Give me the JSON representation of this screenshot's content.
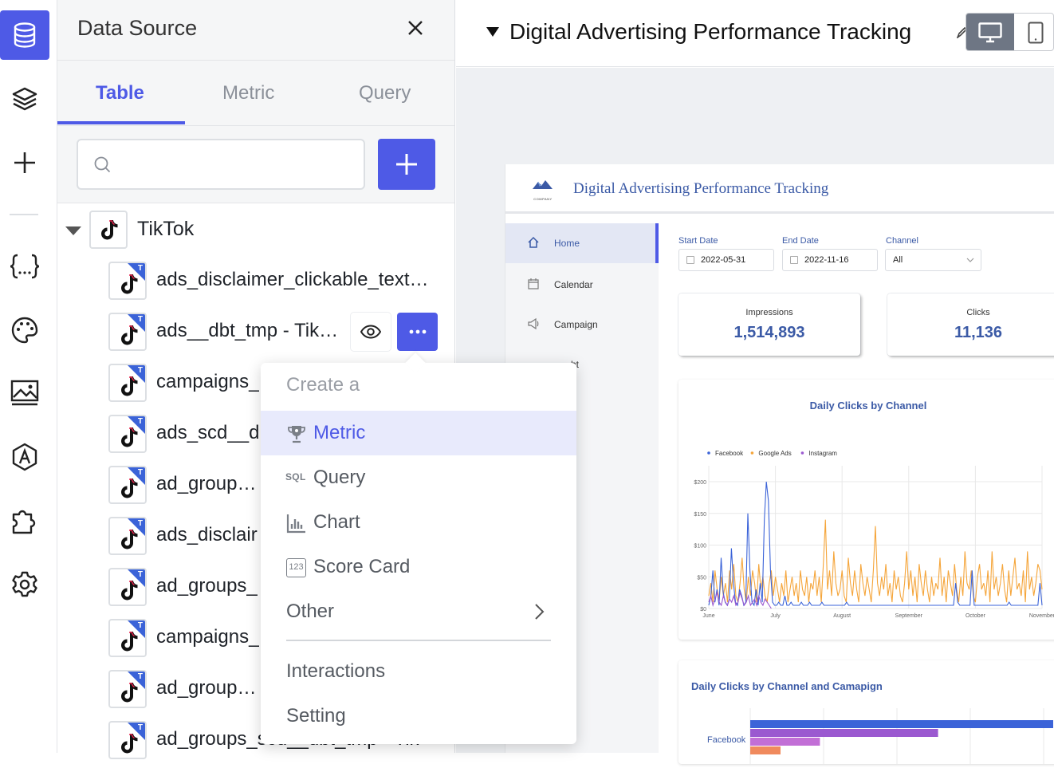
{
  "rail": {
    "items": [
      "data-source-icon",
      "layers-icon",
      "plus-icon",
      "variables-icon",
      "palette-icon",
      "image-icon",
      "theme-icon",
      "puzzle-icon",
      "gear-icon"
    ]
  },
  "panel": {
    "title": "Data Source",
    "tabs": [
      {
        "label": "Table",
        "active": true
      },
      {
        "label": "Metric",
        "active": false
      },
      {
        "label": "Query",
        "active": false
      }
    ],
    "search": {
      "placeholder": "",
      "value": ""
    },
    "tree": {
      "root": "TikTok",
      "tables": [
        "ads_disclaimer_clickable_text…",
        "ads__dbt_tmp - Tik…",
        "campaigns_",
        "ads_scd__d",
        "ad_groups_a",
        "ads_disclair",
        "ad_groups_",
        "campaigns_",
        "ad_groups_t",
        "ad_groups_scd__dbt_tmp - Tik"
      ]
    }
  },
  "menu": {
    "header": "Create a",
    "items": [
      {
        "label": "Metric",
        "icon": "trophy-icon",
        "selected": true
      },
      {
        "label": "Query",
        "icon": "sql-icon",
        "icon_text": "SQL",
        "selected": false
      },
      {
        "label": "Chart",
        "icon": "bar-chart-icon",
        "selected": false
      },
      {
        "label": "Score Card",
        "icon": "scorecard-icon",
        "icon_text": "123",
        "selected": false
      },
      {
        "label": "Other",
        "icon": "chevron-right-icon",
        "selected": false
      }
    ],
    "extra": [
      "Interactions",
      "Setting"
    ]
  },
  "canvas": {
    "title": "Digital Advertising Performance Tracking"
  },
  "dashboard": {
    "title": "Digital Advertising Performance Tracking",
    "logo_text": "COMPANY",
    "nav": [
      {
        "label": "Home",
        "active": true
      },
      {
        "label": "Calendar",
        "active": false
      },
      {
        "label": "Campaign",
        "active": false
      },
      {
        "label": "ht",
        "active": false
      }
    ],
    "filters": {
      "start_label": "Start Date",
      "start_value": "2022-05-31",
      "end_label": "End Date",
      "end_value": "2022-11-16",
      "channel_label": "Channel",
      "channel_value": "All"
    },
    "kpis": [
      {
        "label": "Impressions",
        "value": "1,514,893"
      },
      {
        "label": "Clicks",
        "value": "11,136"
      }
    ],
    "chart2_title": "Daily Clicks by Channel and Camapign",
    "chart2_label": "Facebook"
  },
  "chart_data": {
    "type": "line",
    "title": "Daily Clicks by Channel",
    "xlabel": "",
    "ylabel": "",
    "x_ticks": [
      "June",
      "July",
      "August",
      "September",
      "October",
      "November"
    ],
    "y_ticks": [
      "$0",
      "$50",
      "$100",
      "$150",
      "$200"
    ],
    "ylim": [
      0,
      200
    ],
    "legend_position": "top-left",
    "series": [
      {
        "name": "Facebook",
        "color": "#3b63d8",
        "values": [
          5,
          20,
          60,
          10,
          30,
          5,
          80,
          25,
          10,
          5,
          15,
          95,
          40,
          10,
          5,
          30,
          20,
          5,
          10,
          150,
          60,
          10,
          5,
          30,
          5,
          40,
          10,
          140,
          200,
          170,
          60,
          10,
          5,
          5,
          10,
          5,
          5,
          20,
          5,
          5,
          10,
          5,
          5,
          5,
          5,
          10,
          5,
          5,
          5,
          10,
          5,
          5,
          5,
          5,
          5,
          10,
          5,
          5,
          5,
          5,
          5,
          5,
          5,
          5,
          5,
          5,
          5,
          10,
          5,
          5,
          5,
          5,
          5,
          5,
          5,
          5,
          5,
          5,
          5,
          5,
          5,
          5,
          5,
          5,
          5,
          5,
          5,
          5,
          5,
          5,
          5,
          5,
          5,
          5,
          5,
          5,
          5,
          5,
          5,
          5,
          5,
          5,
          5,
          5,
          5,
          5,
          5,
          5,
          5,
          5,
          5,
          5,
          5,
          5,
          5,
          5,
          5,
          5,
          5,
          5,
          40,
          10,
          5,
          5,
          5,
          5,
          5,
          5,
          60,
          5,
          5,
          5,
          5,
          5,
          5,
          5,
          5,
          5,
          5,
          5,
          5,
          5,
          5,
          5,
          5,
          5,
          10,
          5,
          5,
          5,
          5,
          5,
          5,
          5,
          5,
          5,
          5,
          5,
          5,
          5,
          5,
          40,
          5
        ]
      },
      {
        "name": "Google Ads",
        "color": "#f5a53a",
        "values": [
          20,
          40,
          10,
          60,
          30,
          15,
          50,
          20,
          40,
          10,
          60,
          30,
          70,
          20,
          10,
          40,
          80,
          30,
          10,
          50,
          20,
          60,
          40,
          10,
          70,
          30,
          50,
          20,
          10,
          40,
          60,
          20,
          50,
          30,
          10,
          40,
          20,
          60,
          10,
          30,
          50,
          20,
          40,
          10,
          60,
          30,
          20,
          50,
          10,
          40,
          30,
          60,
          20,
          50,
          10,
          70,
          140,
          30,
          60,
          20,
          90,
          40,
          20,
          30,
          60,
          20,
          10,
          80,
          40,
          20,
          60,
          30,
          10,
          70,
          40,
          20,
          50,
          30,
          10,
          60,
          130,
          40,
          20,
          50,
          30,
          70,
          20,
          40,
          10,
          60,
          30,
          50,
          20,
          10,
          40,
          90,
          30,
          60,
          20,
          50,
          10,
          70,
          40,
          20,
          60,
          30,
          10,
          50,
          20,
          40,
          30,
          80,
          20,
          50,
          10,
          60,
          40,
          20,
          70,
          30,
          10,
          50,
          20,
          90,
          40,
          30,
          60,
          20,
          10,
          50,
          70,
          30,
          40,
          20,
          60,
          10,
          90,
          30,
          50,
          20,
          40,
          70,
          30,
          10,
          60,
          20,
          50,
          80,
          30,
          40,
          20,
          60,
          10,
          90,
          30,
          50,
          20,
          40,
          70,
          60,
          30
        ]
      },
      {
        "name": "Instagram",
        "color": "#9b59d0",
        "values": [
          10,
          20,
          5,
          15,
          25,
          10,
          5,
          20,
          10,
          5,
          15,
          10,
          20,
          5,
          10,
          25,
          15,
          5,
          10,
          20,
          5,
          10,
          15,
          5,
          20,
          10,
          5,
          15,
          10,
          5,
          0,
          0,
          0,
          0,
          0,
          0,
          0,
          0,
          0,
          0,
          0,
          0,
          0,
          0,
          0,
          0,
          0,
          0,
          0,
          0,
          0,
          0,
          0,
          0,
          0,
          0,
          0,
          0,
          0,
          0,
          0,
          0,
          0,
          0,
          0,
          0,
          0,
          0,
          0,
          0,
          0,
          0,
          0,
          0,
          0,
          0,
          0,
          0,
          0,
          0,
          0,
          0,
          0,
          0,
          0,
          0,
          0,
          0,
          0,
          0,
          0,
          0,
          0,
          0,
          0,
          0,
          0,
          0,
          0,
          0,
          0,
          0,
          0,
          0,
          0,
          0,
          0,
          0,
          0,
          0,
          0,
          0,
          0,
          0,
          0,
          0,
          0,
          0,
          0,
          0,
          0,
          0,
          0,
          0,
          0,
          0,
          0,
          0,
          0,
          0,
          0,
          0,
          0,
          0,
          0,
          0,
          0,
          0,
          0,
          0,
          0,
          0,
          0,
          0,
          0,
          0,
          0,
          0,
          0,
          0,
          0,
          0,
          0,
          0,
          0,
          0,
          0,
          0,
          0,
          0,
          0
        ]
      }
    ]
  },
  "chart2_data": {
    "type": "bar",
    "title": "Daily Clicks by Channel and Camapign",
    "categories": [
      "Facebook"
    ],
    "series_colors": [
      "#3b63d8",
      "#9b59d0",
      "#c26fd6",
      "#f08a5d"
    ],
    "values": [
      1.0,
      0.62,
      0.23,
      0.1
    ]
  }
}
